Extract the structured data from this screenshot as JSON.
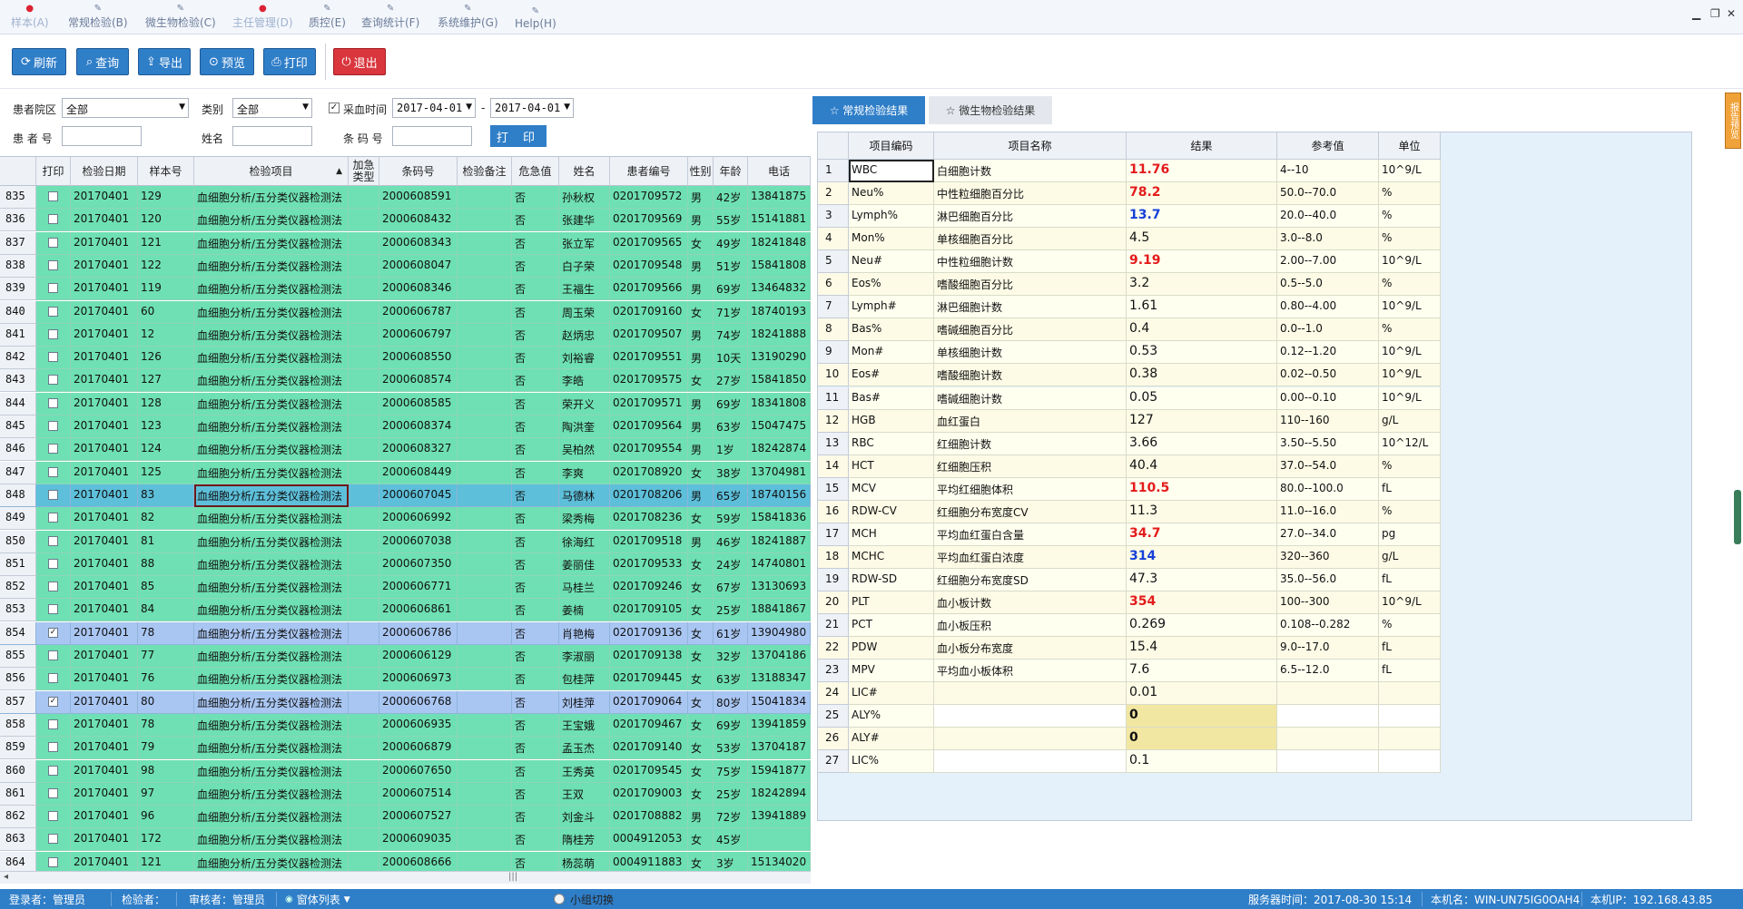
{
  "menu": [
    {
      "label": "样本(A)",
      "mark": "●",
      "mark_color": "red",
      "dim": true
    },
    {
      "label": "常规检验(B)",
      "mark": "✎",
      "dim": false
    },
    {
      "label": "微生物检验(C)",
      "mark": "✎",
      "dim": false
    },
    {
      "label": "主任管理(D)",
      "mark": "●",
      "mark_color": "red",
      "dim": true
    },
    {
      "label": "质控(E)",
      "mark": "✎",
      "dim": false
    },
    {
      "label": "查询统计(F)",
      "mark": "✎",
      "dim": false
    },
    {
      "label": "系统维护(G)",
      "mark": "✎",
      "dim": false
    },
    {
      "label": "Help(H)",
      "mark": "✎",
      "dim": false
    }
  ],
  "window_controls": {
    "minimize": "▁",
    "restore": "❐",
    "close": "✕"
  },
  "toolbar": {
    "refresh": "刷新",
    "query": "查询",
    "export": "导出",
    "preview": "预览",
    "print": "打印",
    "exit": "退出"
  },
  "filters": {
    "district_label": "患者院区",
    "district_value": "全部",
    "category_label": "类别",
    "category_value": "全部",
    "collect_time_label": "采血时间",
    "collect_time_checked": true,
    "date_from": "2017-04-01",
    "date_sep": "-",
    "date_to": "2017-04-01",
    "patient_no_label": "患 者 号",
    "patient_no_value": "",
    "name_label": "姓名",
    "name_value": "",
    "barcode_label": "条 码 号",
    "barcode_value": "",
    "print_button": "打 印"
  },
  "left_grid": {
    "columns": [
      "打印",
      "检验日期",
      "样本号",
      "检验项目",
      "加急类型",
      "条码号",
      "检验备注",
      "危急值",
      "姓名",
      "患者编号",
      "性别",
      "年龄",
      "电话"
    ],
    "sort_indicator": "▲",
    "rows": [
      {
        "rn": "835",
        "print": false,
        "date": "20170401",
        "sample": "129",
        "item": "血细胞分析/五分类仪器检测法",
        "urgent": "",
        "barcode": "2000608591",
        "remark": "",
        "critical": "否",
        "name": "孙秋权",
        "pid": "0201709572",
        "sex": "男",
        "age": "42岁",
        "phone": "13841875"
      },
      {
        "rn": "836",
        "print": false,
        "date": "20170401",
        "sample": "120",
        "item": "血细胞分析/五分类仪器检测法",
        "urgent": "",
        "barcode": "2000608432",
        "remark": "",
        "critical": "否",
        "name": "张建华",
        "pid": "0201709569",
        "sex": "男",
        "age": "55岁",
        "phone": "15141881"
      },
      {
        "rn": "837",
        "print": false,
        "date": "20170401",
        "sample": "121",
        "item": "血细胞分析/五分类仪器检测法",
        "urgent": "",
        "barcode": "2000608343",
        "remark": "",
        "critical": "否",
        "name": "张立军",
        "pid": "0201709565",
        "sex": "女",
        "age": "49岁",
        "phone": "18241848"
      },
      {
        "rn": "838",
        "print": false,
        "date": "20170401",
        "sample": "122",
        "item": "血细胞分析/五分类仪器检测法",
        "urgent": "",
        "barcode": "2000608047",
        "remark": "",
        "critical": "否",
        "name": "白子荣",
        "pid": "0201709548",
        "sex": "男",
        "age": "51岁",
        "phone": "15841808"
      },
      {
        "rn": "839",
        "print": false,
        "date": "20170401",
        "sample": "119",
        "item": "血细胞分析/五分类仪器检测法",
        "urgent": "",
        "barcode": "2000608346",
        "remark": "",
        "critical": "否",
        "name": "王福生",
        "pid": "0201709566",
        "sex": "男",
        "age": "69岁",
        "phone": "13464832"
      },
      {
        "rn": "840",
        "print": false,
        "date": "20170401",
        "sample": "60",
        "item": "血细胞分析/五分类仪器检测法",
        "urgent": "",
        "barcode": "2000606787",
        "remark": "",
        "critical": "否",
        "name": "周玉荣",
        "pid": "0201709160",
        "sex": "女",
        "age": "71岁",
        "phone": "18740193"
      },
      {
        "rn": "841",
        "print": false,
        "date": "20170401",
        "sample": "12",
        "item": "血细胞分析/五分类仪器检测法",
        "urgent": "",
        "barcode": "2000606797",
        "remark": "",
        "critical": "否",
        "name": "赵炳忠",
        "pid": "0201709507",
        "sex": "男",
        "age": "74岁",
        "phone": "18241888"
      },
      {
        "rn": "842",
        "print": false,
        "date": "20170401",
        "sample": "126",
        "item": "血细胞分析/五分类仪器检测法",
        "urgent": "",
        "barcode": "2000608550",
        "remark": "",
        "critical": "否",
        "name": "刘裕睿",
        "pid": "0201709551",
        "sex": "男",
        "age": "10天",
        "phone": "13190290"
      },
      {
        "rn": "843",
        "print": false,
        "date": "20170401",
        "sample": "127",
        "item": "血细胞分析/五分类仪器检测法",
        "urgent": "",
        "barcode": "2000608574",
        "remark": "",
        "critical": "否",
        "name": "李皓",
        "pid": "0201709575",
        "sex": "女",
        "age": "27岁",
        "phone": "15841850"
      },
      {
        "rn": "844",
        "print": false,
        "date": "20170401",
        "sample": "128",
        "item": "血细胞分析/五分类仪器检测法",
        "urgent": "",
        "barcode": "2000608585",
        "remark": "",
        "critical": "否",
        "name": "荣开义",
        "pid": "0201709571",
        "sex": "男",
        "age": "69岁",
        "phone": "18341808"
      },
      {
        "rn": "845",
        "print": false,
        "date": "20170401",
        "sample": "123",
        "item": "血细胞分析/五分类仪器检测法",
        "urgent": "",
        "barcode": "2000608374",
        "remark": "",
        "critical": "否",
        "name": "陶洪奎",
        "pid": "0201709564",
        "sex": "男",
        "age": "63岁",
        "phone": "15047475"
      },
      {
        "rn": "846",
        "print": false,
        "date": "20170401",
        "sample": "124",
        "item": "血细胞分析/五分类仪器检测法",
        "urgent": "",
        "barcode": "2000608327",
        "remark": "",
        "critical": "否",
        "name": "吴柏然",
        "pid": "0201709554",
        "sex": "男",
        "age": "1岁",
        "phone": "18242874"
      },
      {
        "rn": "847",
        "print": false,
        "date": "20170401",
        "sample": "125",
        "item": "血细胞分析/五分类仪器检测法",
        "urgent": "",
        "barcode": "2000608449",
        "remark": "",
        "critical": "否",
        "name": "李爽",
        "pid": "0201708920",
        "sex": "女",
        "age": "38岁",
        "phone": "13704981"
      },
      {
        "rn": "848",
        "print": false,
        "date": "20170401",
        "sample": "83",
        "item": "血细胞分析/五分类仪器检测法",
        "urgent": "",
        "barcode": "2000607045",
        "remark": "",
        "critical": "否",
        "name": "马德林",
        "pid": "0201708206",
        "sex": "男",
        "age": "65岁",
        "phone": "18740156",
        "state": "sel"
      },
      {
        "rn": "849",
        "print": false,
        "date": "20170401",
        "sample": "82",
        "item": "血细胞分析/五分类仪器检测法",
        "urgent": "",
        "barcode": "2000606992",
        "remark": "",
        "critical": "否",
        "name": "梁秀梅",
        "pid": "0201708236",
        "sex": "女",
        "age": "59岁",
        "phone": "15841836"
      },
      {
        "rn": "850",
        "print": false,
        "date": "20170401",
        "sample": "81",
        "item": "血细胞分析/五分类仪器检测法",
        "urgent": "",
        "barcode": "2000607038",
        "remark": "",
        "critical": "否",
        "name": "徐海红",
        "pid": "0201709518",
        "sex": "男",
        "age": "46岁",
        "phone": "18241887"
      },
      {
        "rn": "851",
        "print": false,
        "date": "20170401",
        "sample": "88",
        "item": "血细胞分析/五分类仪器检测法",
        "urgent": "",
        "barcode": "2000607350",
        "remark": "",
        "critical": "否",
        "name": "姜丽佳",
        "pid": "0201709533",
        "sex": "女",
        "age": "24岁",
        "phone": "14740801"
      },
      {
        "rn": "852",
        "print": false,
        "date": "20170401",
        "sample": "85",
        "item": "血细胞分析/五分类仪器检测法",
        "urgent": "",
        "barcode": "2000606771",
        "remark": "",
        "critical": "否",
        "name": "马桂兰",
        "pid": "0201709246",
        "sex": "女",
        "age": "67岁",
        "phone": "13130693"
      },
      {
        "rn": "853",
        "print": false,
        "date": "20170401",
        "sample": "84",
        "item": "血细胞分析/五分类仪器检测法",
        "urgent": "",
        "barcode": "2000606861",
        "remark": "",
        "critical": "否",
        "name": "姜楠",
        "pid": "0201709105",
        "sex": "女",
        "age": "25岁",
        "phone": "18841867"
      },
      {
        "rn": "854",
        "print": true,
        "date": "20170401",
        "sample": "78",
        "item": "血细胞分析/五分类仪器检测法",
        "urgent": "",
        "barcode": "2000606786",
        "remark": "",
        "critical": "否",
        "name": "肖艳梅",
        "pid": "0201709136",
        "sex": "女",
        "age": "61岁",
        "phone": "13904980",
        "state": "chkd"
      },
      {
        "rn": "855",
        "print": false,
        "date": "20170401",
        "sample": "77",
        "item": "血细胞分析/五分类仪器检测法",
        "urgent": "",
        "barcode": "2000606129",
        "remark": "",
        "critical": "否",
        "name": "李淑丽",
        "pid": "0201709138",
        "sex": "女",
        "age": "32岁",
        "phone": "13704186"
      },
      {
        "rn": "856",
        "print": false,
        "date": "20170401",
        "sample": "76",
        "item": "血细胞分析/五分类仪器检测法",
        "urgent": "",
        "barcode": "2000606973",
        "remark": "",
        "critical": "否",
        "name": "包桂萍",
        "pid": "0201709445",
        "sex": "女",
        "age": "63岁",
        "phone": "13188347"
      },
      {
        "rn": "857",
        "print": true,
        "date": "20170401",
        "sample": "80",
        "item": "血细胞分析/五分类仪器检测法",
        "urgent": "",
        "barcode": "2000606768",
        "remark": "",
        "critical": "否",
        "name": "刘桂萍",
        "pid": "0201709064",
        "sex": "女",
        "age": "80岁",
        "phone": "15041834",
        "state": "chkd"
      },
      {
        "rn": "858",
        "print": false,
        "date": "20170401",
        "sample": "78",
        "item": "血细胞分析/五分类仪器检测法",
        "urgent": "",
        "barcode": "2000606935",
        "remark": "",
        "critical": "否",
        "name": "王宝娥",
        "pid": "0201709467",
        "sex": "女",
        "age": "69岁",
        "phone": "13941859"
      },
      {
        "rn": "859",
        "print": false,
        "date": "20170401",
        "sample": "79",
        "item": "血细胞分析/五分类仪器检测法",
        "urgent": "",
        "barcode": "2000606879",
        "remark": "",
        "critical": "否",
        "name": "孟玉杰",
        "pid": "0201709140",
        "sex": "女",
        "age": "53岁",
        "phone": "13704187"
      },
      {
        "rn": "860",
        "print": false,
        "date": "20170401",
        "sample": "98",
        "item": "血细胞分析/五分类仪器检测法",
        "urgent": "",
        "barcode": "2000607650",
        "remark": "",
        "critical": "否",
        "name": "王秀英",
        "pid": "0201709545",
        "sex": "女",
        "age": "75岁",
        "phone": "15941877"
      },
      {
        "rn": "861",
        "print": false,
        "date": "20170401",
        "sample": "97",
        "item": "血细胞分析/五分类仪器检测法",
        "urgent": "",
        "barcode": "2000607514",
        "remark": "",
        "critical": "否",
        "name": "王双",
        "pid": "0201709003",
        "sex": "女",
        "age": "25岁",
        "phone": "18242894"
      },
      {
        "rn": "862",
        "print": false,
        "date": "20170401",
        "sample": "96",
        "item": "血细胞分析/五分类仪器检测法",
        "urgent": "",
        "barcode": "2000607527",
        "remark": "",
        "critical": "否",
        "name": "刘金斗",
        "pid": "0201708882",
        "sex": "男",
        "age": "72岁",
        "phone": "13941889"
      },
      {
        "rn": "863",
        "print": false,
        "date": "20170401",
        "sample": "172",
        "item": "血细胞分析/五分类仪器检测法",
        "urgent": "",
        "barcode": "2000609035",
        "remark": "",
        "critical": "否",
        "name": "隋桂芳",
        "pid": "0004912053",
        "sex": "女",
        "age": "45岁",
        "phone": ""
      },
      {
        "rn": "864",
        "print": false,
        "date": "20170401",
        "sample": "121",
        "item": "血细胞分析/五分类仪器检测法",
        "urgent": "",
        "barcode": "2000608666",
        "remark": "",
        "critical": "否",
        "name": "杨蕊萌",
        "pid": "0004911883",
        "sex": "女",
        "age": "3岁",
        "phone": "15134020"
      }
    ]
  },
  "right_tabs": {
    "routine": "☆ 常规检验结果",
    "micro": "☆ 微生物检验结果"
  },
  "side_tab": "报告预览",
  "result_grid": {
    "columns": [
      "项目编码",
      "项目名称",
      "结果",
      "参考值",
      "单位"
    ],
    "rows": [
      {
        "n": "1",
        "code": "WBC",
        "name": "白细胞计数",
        "result": "11.76",
        "flag": "hi",
        "ref": "4--10",
        "unit": "10^9/L"
      },
      {
        "n": "2",
        "code": "Neu%",
        "name": "中性粒细胞百分比",
        "result": "78.2",
        "flag": "hi",
        "ref": "50.0--70.0",
        "unit": "%"
      },
      {
        "n": "3",
        "code": "Lymph%",
        "name": "淋巴细胞百分比",
        "result": "13.7",
        "flag": "lo",
        "ref": "20.0--40.0",
        "unit": "%"
      },
      {
        "n": "4",
        "code": "Mon%",
        "name": "单核细胞百分比",
        "result": "4.5",
        "flag": "",
        "ref": "3.0--8.0",
        "unit": "%"
      },
      {
        "n": "5",
        "code": "Neu#",
        "name": "中性粒细胞计数",
        "result": "9.19",
        "flag": "hi",
        "ref": "2.00--7.00",
        "unit": "10^9/L"
      },
      {
        "n": "6",
        "code": "Eos%",
        "name": "嗜酸细胞百分比",
        "result": "3.2",
        "flag": "",
        "ref": "0.5--5.0",
        "unit": "%"
      },
      {
        "n": "7",
        "code": "Lymph#",
        "name": "淋巴细胞计数",
        "result": "1.61",
        "flag": "",
        "ref": "0.80--4.00",
        "unit": "10^9/L"
      },
      {
        "n": "8",
        "code": "Bas%",
        "name": "嗜碱细胞百分比",
        "result": "0.4",
        "flag": "",
        "ref": "0.0--1.0",
        "unit": "%"
      },
      {
        "n": "9",
        "code": "Mon#",
        "name": "单核细胞计数",
        "result": "0.53",
        "flag": "",
        "ref": "0.12--1.20",
        "unit": "10^9/L"
      },
      {
        "n": "10",
        "code": "Eos#",
        "name": "嗜酸细胞计数",
        "result": "0.38",
        "flag": "",
        "ref": "0.02--0.50",
        "unit": "10^9/L"
      },
      {
        "n": "11",
        "code": "Bas#",
        "name": "嗜碱细胞计数",
        "result": "0.05",
        "flag": "",
        "ref": "0.00--0.10",
        "unit": "10^9/L"
      },
      {
        "n": "12",
        "code": "HGB",
        "name": "血红蛋白",
        "result": "127",
        "flag": "",
        "ref": "110--160",
        "unit": "g/L"
      },
      {
        "n": "13",
        "code": "RBC",
        "name": "红细胞计数",
        "result": "3.66",
        "flag": "",
        "ref": "3.50--5.50",
        "unit": "10^12/L"
      },
      {
        "n": "14",
        "code": "HCT",
        "name": "红细胞压积",
        "result": "40.4",
        "flag": "",
        "ref": "37.0--54.0",
        "unit": "%"
      },
      {
        "n": "15",
        "code": "MCV",
        "name": "平均红细胞体积",
        "result": "110.5",
        "flag": "hi",
        "ref": "80.0--100.0",
        "unit": "fL"
      },
      {
        "n": "16",
        "code": "RDW-CV",
        "name": "红细胞分布宽度CV",
        "result": "11.3",
        "flag": "",
        "ref": "11.0--16.0",
        "unit": "%"
      },
      {
        "n": "17",
        "code": "MCH",
        "name": "平均血红蛋白含量",
        "result": "34.7",
        "flag": "hi",
        "ref": "27.0--34.0",
        "unit": "pg"
      },
      {
        "n": "18",
        "code": "MCHC",
        "name": "平均血红蛋白浓度",
        "result": "314",
        "flag": "lo",
        "ref": "320--360",
        "unit": "g/L"
      },
      {
        "n": "19",
        "code": "RDW-SD",
        "name": "红细胞分布宽度SD",
        "result": "47.3",
        "flag": "",
        "ref": "35.0--56.0",
        "unit": "fL"
      },
      {
        "n": "20",
        "code": "PLT",
        "name": "血小板计数",
        "result": "354",
        "flag": "hi",
        "ref": "100--300",
        "unit": "10^9/L"
      },
      {
        "n": "21",
        "code": "PCT",
        "name": "血小板压积",
        "result": "0.269",
        "flag": "",
        "ref": "0.108--0.282",
        "unit": "%"
      },
      {
        "n": "22",
        "code": "PDW",
        "name": "血小板分布宽度",
        "result": "15.4",
        "flag": "",
        "ref": "9.0--17.0",
        "unit": "fL"
      },
      {
        "n": "23",
        "code": "MPV",
        "name": "平均血小板体积",
        "result": "7.6",
        "flag": "",
        "ref": "6.5--12.0",
        "unit": "fL"
      },
      {
        "n": "24",
        "code": "LIC#",
        "name": "",
        "result": "0.01",
        "flag": "",
        "ref": "",
        "unit": ""
      },
      {
        "n": "25",
        "code": "ALY%",
        "name": "",
        "result": "0",
        "flag": "yellow",
        "ref": "",
        "unit": ""
      },
      {
        "n": "26",
        "code": "ALY#",
        "name": "",
        "result": "0",
        "flag": "yellow",
        "ref": "",
        "unit": ""
      },
      {
        "n": "27",
        "code": "LIC%",
        "name": "",
        "result": "0.1",
        "flag": "",
        "ref": "",
        "unit": ""
      }
    ]
  },
  "status": {
    "login": "登录者：管理员",
    "inspector": "检验者：",
    "reviewer": "审核者：管理员",
    "window_list": "窗体列表",
    "group_switch": "小组切换",
    "server_time": "服务器时间：2017-08-30 15:14",
    "host": "本机名：WIN-UN75IG0OAH4",
    "ip": "本机IP：192.168.43.85"
  },
  "colors": {
    "row": "#6ee0b3",
    "row_selected": "#5dbfda",
    "row_checked": "#a9c6f3",
    "accent": "#2f7ec8",
    "high": "#e31b1b",
    "low": "#1540d8"
  }
}
